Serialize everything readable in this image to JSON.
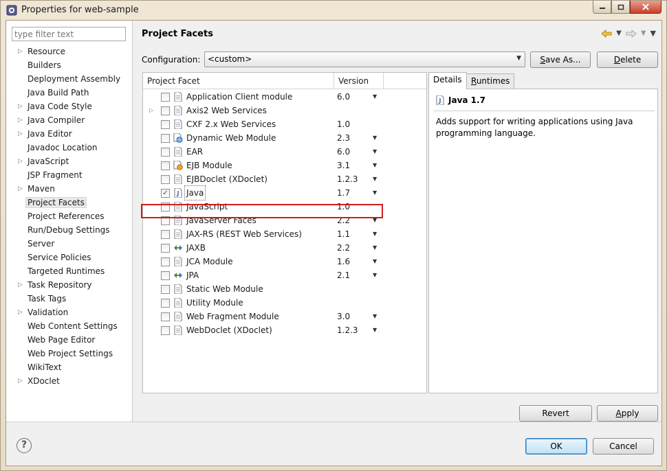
{
  "window": {
    "title": "Properties for web-sample"
  },
  "filter": {
    "placeholder": "type filter text"
  },
  "nav": [
    {
      "label": "Resource",
      "expandable": true
    },
    {
      "label": "Builders",
      "expandable": false
    },
    {
      "label": "Deployment Assembly",
      "expandable": false
    },
    {
      "label": "Java Build Path",
      "expandable": false
    },
    {
      "label": "Java Code Style",
      "expandable": true
    },
    {
      "label": "Java Compiler",
      "expandable": true
    },
    {
      "label": "Java Editor",
      "expandable": true
    },
    {
      "label": "Javadoc Location",
      "expandable": false
    },
    {
      "label": "JavaScript",
      "expandable": true
    },
    {
      "label": "JSP Fragment",
      "expandable": false
    },
    {
      "label": "Maven",
      "expandable": true
    },
    {
      "label": "Project Facets",
      "expandable": false,
      "selected": true
    },
    {
      "label": "Project References",
      "expandable": false
    },
    {
      "label": "Run/Debug Settings",
      "expandable": false
    },
    {
      "label": "Server",
      "expandable": false
    },
    {
      "label": "Service Policies",
      "expandable": false
    },
    {
      "label": "Targeted Runtimes",
      "expandable": false
    },
    {
      "label": "Task Repository",
      "expandable": true
    },
    {
      "label": "Task Tags",
      "expandable": false
    },
    {
      "label": "Validation",
      "expandable": true
    },
    {
      "label": "Web Content Settings",
      "expandable": false
    },
    {
      "label": "Web Page Editor",
      "expandable": false
    },
    {
      "label": "Web Project Settings",
      "expandable": false
    },
    {
      "label": "WikiText",
      "expandable": false
    },
    {
      "label": "XDoclet",
      "expandable": true
    }
  ],
  "page": {
    "title": "Project Facets"
  },
  "config": {
    "label": "Configuration:",
    "value": "<custom>",
    "save_as_prefix": "",
    "save_as_u": "S",
    "save_as_rest": "ave As...",
    "delete_u": "D",
    "delete_rest": "elete"
  },
  "table": {
    "col_facet": "Project Facet",
    "col_version": "Version",
    "rows": [
      {
        "name": "Application Client module",
        "version": "6.0",
        "dropdown": true,
        "checked": false,
        "icon": "page-icon"
      },
      {
        "name": "Axis2 Web Services",
        "version": "",
        "dropdown": false,
        "checked": false,
        "icon": "page-icon",
        "expandable": true
      },
      {
        "name": "CXF 2.x Web Services",
        "version": "1.0",
        "dropdown": false,
        "checked": false,
        "icon": "page-icon"
      },
      {
        "name": "Dynamic Web Module",
        "version": "2.3",
        "dropdown": true,
        "checked": false,
        "icon": "web-module-icon"
      },
      {
        "name": "EAR",
        "version": "6.0",
        "dropdown": true,
        "checked": false,
        "icon": "page-icon"
      },
      {
        "name": "EJB Module",
        "version": "3.1",
        "dropdown": true,
        "checked": false,
        "icon": "ejb-icon"
      },
      {
        "name": "EJBDoclet (XDoclet)",
        "version": "1.2.3",
        "dropdown": true,
        "checked": false,
        "icon": "page-icon"
      },
      {
        "name": "Java",
        "version": "1.7",
        "dropdown": true,
        "checked": true,
        "icon": "java-icon",
        "highlighted": true
      },
      {
        "name": "JavaScript",
        "version": "1.0",
        "dropdown": false,
        "checked": false,
        "icon": "page-icon"
      },
      {
        "name": "JavaServer Faces",
        "version": "2.2",
        "dropdown": true,
        "checked": false,
        "icon": "page-icon"
      },
      {
        "name": "JAX-RS (REST Web Services)",
        "version": "1.1",
        "dropdown": true,
        "checked": false,
        "icon": "page-icon"
      },
      {
        "name": "JAXB",
        "version": "2.2",
        "dropdown": true,
        "checked": false,
        "icon": "jaxb-icon"
      },
      {
        "name": "JCA Module",
        "version": "1.6",
        "dropdown": true,
        "checked": false,
        "icon": "page-icon"
      },
      {
        "name": "JPA",
        "version": "2.1",
        "dropdown": true,
        "checked": false,
        "icon": "jpa-icon"
      },
      {
        "name": "Static Web Module",
        "version": "",
        "dropdown": false,
        "checked": false,
        "icon": "page-icon"
      },
      {
        "name": "Utility Module",
        "version": "",
        "dropdown": false,
        "checked": false,
        "icon": "page-icon"
      },
      {
        "name": "Web Fragment Module",
        "version": "3.0",
        "dropdown": true,
        "checked": false,
        "icon": "page-icon"
      },
      {
        "name": "WebDoclet (XDoclet)",
        "version": "1.2.3",
        "dropdown": true,
        "checked": false,
        "icon": "page-icon"
      }
    ]
  },
  "details": {
    "tab_details": "Details",
    "tab_runtimes_u": "R",
    "tab_runtimes_rest": "untimes",
    "heading": "Java 1.7",
    "description": "Adds support for writing applications using Java programming language."
  },
  "buttons": {
    "revert": "Revert",
    "apply_u": "A",
    "apply_rest": "pply",
    "ok": "OK",
    "cancel": "Cancel"
  },
  "colors": {
    "highlight_box": "#d01c1c",
    "ok_border": "#3c7fb1"
  }
}
